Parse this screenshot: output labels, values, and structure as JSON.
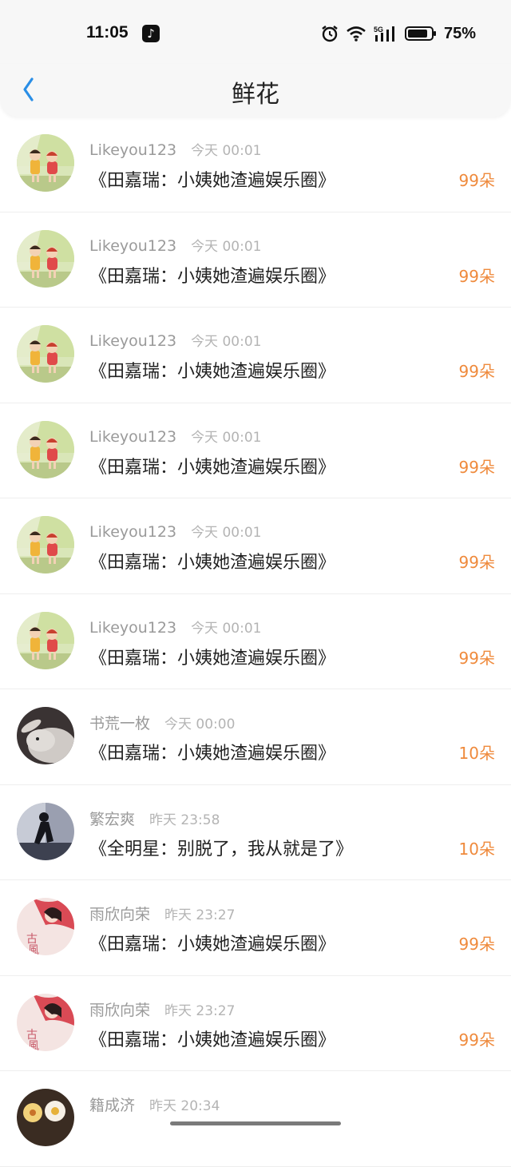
{
  "status": {
    "time": "11:05",
    "battery": "75%"
  },
  "nav": {
    "title": "鲜花"
  },
  "items": [
    {
      "name": "Likeyou123",
      "time": "今天 00:01",
      "book": "《田嘉瑞：小姨她渣遍娱乐圈》",
      "count": "99朵",
      "avatar": "cartoon-kids"
    },
    {
      "name": "Likeyou123",
      "time": "今天 00:01",
      "book": "《田嘉瑞：小姨她渣遍娱乐圈》",
      "count": "99朵",
      "avatar": "cartoon-kids"
    },
    {
      "name": "Likeyou123",
      "time": "今天 00:01",
      "book": "《田嘉瑞：小姨她渣遍娱乐圈》",
      "count": "99朵",
      "avatar": "cartoon-kids"
    },
    {
      "name": "Likeyou123",
      "time": "今天 00:01",
      "book": "《田嘉瑞：小姨她渣遍娱乐圈》",
      "count": "99朵",
      "avatar": "cartoon-kids"
    },
    {
      "name": "Likeyou123",
      "time": "今天 00:01",
      "book": "《田嘉瑞：小姨她渣遍娱乐圈》",
      "count": "99朵",
      "avatar": "cartoon-kids"
    },
    {
      "name": "Likeyou123",
      "time": "今天 00:01",
      "book": "《田嘉瑞：小姨她渣遍娱乐圈》",
      "count": "99朵",
      "avatar": "cartoon-kids"
    },
    {
      "name": "书荒一枚",
      "time": "今天 00:00",
      "book": "《田嘉瑞：小姨她渣遍娱乐圈》",
      "count": "10朵",
      "avatar": "rabbit"
    },
    {
      "name": "繁宏爽",
      "time": "昨天 23:58",
      "book": "《全明星：别脱了，我从就是了》",
      "count": "10朵",
      "avatar": "silhouette"
    },
    {
      "name": "雨欣向荣",
      "time": "昨天 23:27",
      "book": "《田嘉瑞：小姨她渣遍娱乐圈》",
      "count": "99朵",
      "avatar": "girl-red"
    },
    {
      "name": "雨欣向荣",
      "time": "昨天 23:27",
      "book": "《田嘉瑞：小姨她渣遍娱乐圈》",
      "count": "99朵",
      "avatar": "girl-red"
    },
    {
      "name": "籍成济",
      "time": "昨天 20:34",
      "book": "",
      "count": "",
      "avatar": "flowers"
    }
  ],
  "colors": {
    "accent": "#1e88e5",
    "count": "#ef8a3c"
  }
}
